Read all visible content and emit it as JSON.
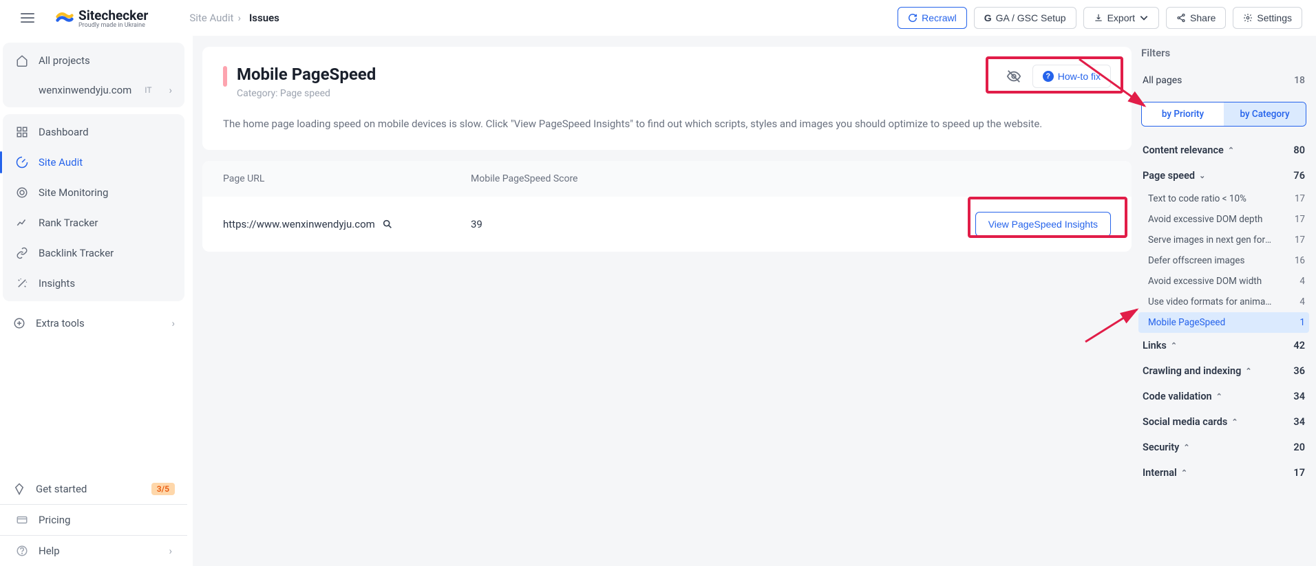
{
  "header": {
    "logo_text": "Sitechecker",
    "logo_sub": "Proudly made in Ukraine",
    "breadcrumb_parent": "Site Audit",
    "breadcrumb_sep": "›",
    "breadcrumb_current": "Issues",
    "recrawl": "Recrawl",
    "ga_gsc": "GA / GSC Setup",
    "export": "Export",
    "share": "Share",
    "settings": "Settings"
  },
  "sidebar": {
    "all_projects": "All projects",
    "site": "wenxinwendyju.com",
    "site_badge": "IT",
    "items": {
      "dashboard": "Dashboard",
      "site_audit": "Site Audit",
      "site_monitoring": "Site Monitoring",
      "rank_tracker": "Rank Tracker",
      "backlink_tracker": "Backlink Tracker",
      "insights": "Insights"
    },
    "extra_tools": "Extra tools",
    "get_started": "Get started",
    "get_started_badge": "3/5",
    "pricing": "Pricing",
    "help": "Help"
  },
  "issue": {
    "title": "Mobile PageSpeed",
    "category_label": "Category: Page speed",
    "howto": "How-to fix",
    "description": "The home page loading speed on mobile devices is slow. Click \"View PageSpeed Insights\" to find out which scripts, styles and images you should optimize to speed up the website."
  },
  "table": {
    "col_url": "Page URL",
    "col_score": "Mobile PageSpeed Score",
    "row_url": "https://www.wenxinwendyju.com",
    "row_score": "39",
    "view_btn": "View PageSpeed Insights"
  },
  "filters": {
    "title": "Filters",
    "all_pages": "All pages",
    "all_pages_count": "18",
    "by_priority": "by Priority",
    "by_category": "by Category",
    "cats": [
      {
        "label": "Content relevance",
        "count": "80",
        "expanded": false
      },
      {
        "label": "Page speed",
        "count": "76",
        "expanded": true,
        "items": [
          {
            "label": "Text to code ratio < 10%",
            "count": "17"
          },
          {
            "label": "Avoid excessive DOM depth",
            "count": "17"
          },
          {
            "label": "Serve images in next gen forma...",
            "count": "17"
          },
          {
            "label": "Defer offscreen images",
            "count": "16"
          },
          {
            "label": "Avoid excessive DOM width",
            "count": "4"
          },
          {
            "label": "Use video formats for animated ...",
            "count": "4"
          },
          {
            "label": "Mobile PageSpeed",
            "count": "1",
            "selected": true
          }
        ]
      },
      {
        "label": "Links",
        "count": "42",
        "expanded": false
      },
      {
        "label": "Crawling and indexing",
        "count": "36",
        "expanded": false
      },
      {
        "label": "Code validation",
        "count": "34",
        "expanded": false
      },
      {
        "label": "Social media cards",
        "count": "34",
        "expanded": false
      },
      {
        "label": "Security",
        "count": "20",
        "expanded": false
      },
      {
        "label": "Internal",
        "count": "17",
        "expanded": false
      }
    ]
  }
}
